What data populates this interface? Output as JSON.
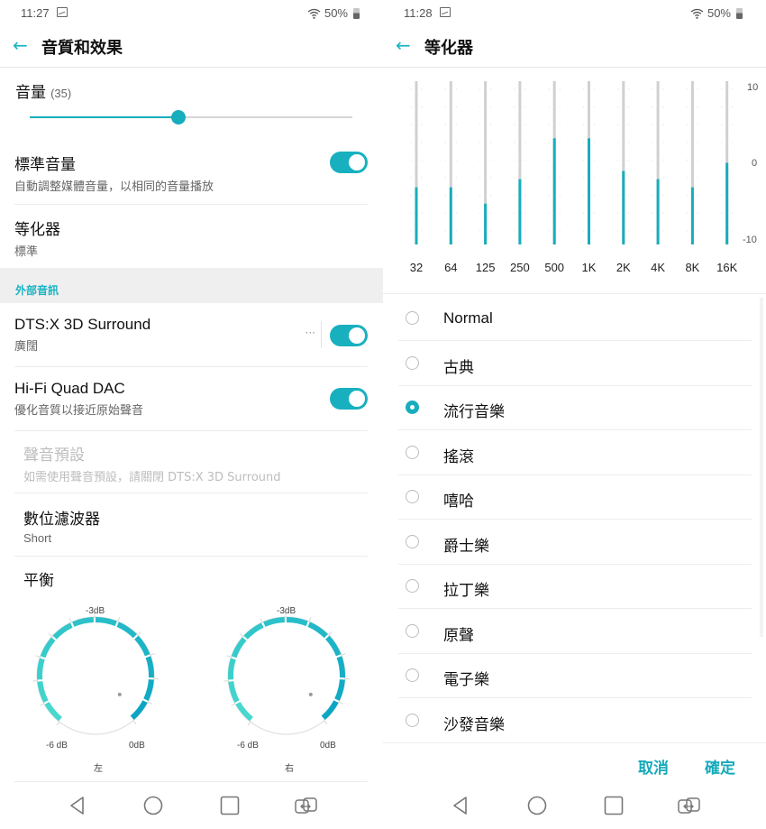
{
  "left_screen": {
    "status": {
      "time": "11:27",
      "battery": "50%"
    },
    "appbar": {
      "back": "←",
      "title": "音質和效果"
    },
    "volume": {
      "label": "音量",
      "value_text": "(35)",
      "fraction": 0.46
    },
    "items": [
      {
        "title": "標準音量",
        "subtitle": "自動調整媒體音量，以相同的音量播放",
        "toggle": true
      },
      {
        "title": "等化器",
        "subtitle": "標準"
      }
    ],
    "section_header": "外部音訊",
    "external": [
      {
        "title": "DTS:X 3D Surround",
        "subtitle": "廣闊",
        "toggle": true,
        "more": "···"
      },
      {
        "title": "Hi-Fi Quad DAC",
        "subtitle": "優化音質以接近原始聲音",
        "toggle": true
      },
      {
        "title": "聲音預設",
        "subtitle": "如需使用聲音預設，請關閉 DTS:X 3D Surround",
        "disabled": true
      },
      {
        "title": "數位濾波器",
        "subtitle": "Short"
      },
      {
        "title": "平衡"
      }
    ],
    "balance": {
      "dials": [
        {
          "name": "左",
          "top_label": "-3dB",
          "min_label": "-6 dB",
          "max_label": "0dB",
          "value_db": 0
        },
        {
          "name": "右",
          "top_label": "-3dB",
          "min_label": "-6 dB",
          "max_label": "0dB",
          "value_db": 0
        }
      ]
    }
  },
  "right_screen": {
    "status": {
      "time": "11:28",
      "battery": "50%"
    },
    "appbar": {
      "back": "←",
      "title": "等化器"
    },
    "presets": [
      {
        "label": "Normal",
        "selected": false
      },
      {
        "label": "古典",
        "selected": false
      },
      {
        "label": "流行音樂",
        "selected": true
      },
      {
        "label": "搖滾",
        "selected": false
      },
      {
        "label": "嘻哈",
        "selected": false
      },
      {
        "label": "爵士樂",
        "selected": false
      },
      {
        "label": "拉丁樂",
        "selected": false
      },
      {
        "label": "原聲",
        "selected": false
      },
      {
        "label": "電子樂",
        "selected": false
      },
      {
        "label": "沙發音樂",
        "selected": false
      }
    ],
    "actions": {
      "cancel": "取消",
      "confirm": "確定"
    }
  },
  "chart_data": {
    "type": "bar",
    "title": "",
    "categories": [
      "32",
      "64",
      "125",
      "250",
      "500",
      "1K",
      "2K",
      "4K",
      "8K",
      "16K"
    ],
    "values": [
      -3,
      -3,
      -5,
      -2,
      3,
      3,
      -1,
      -2,
      -3,
      0
    ],
    "ylim": [
      -10,
      10
    ],
    "yticks": [
      "10",
      "0",
      "-10"
    ],
    "xlabel": "",
    "ylabel": ""
  },
  "colors": {
    "accent": "#17adbd",
    "track": "#d0d0d0",
    "section_bg": "#efefef"
  }
}
